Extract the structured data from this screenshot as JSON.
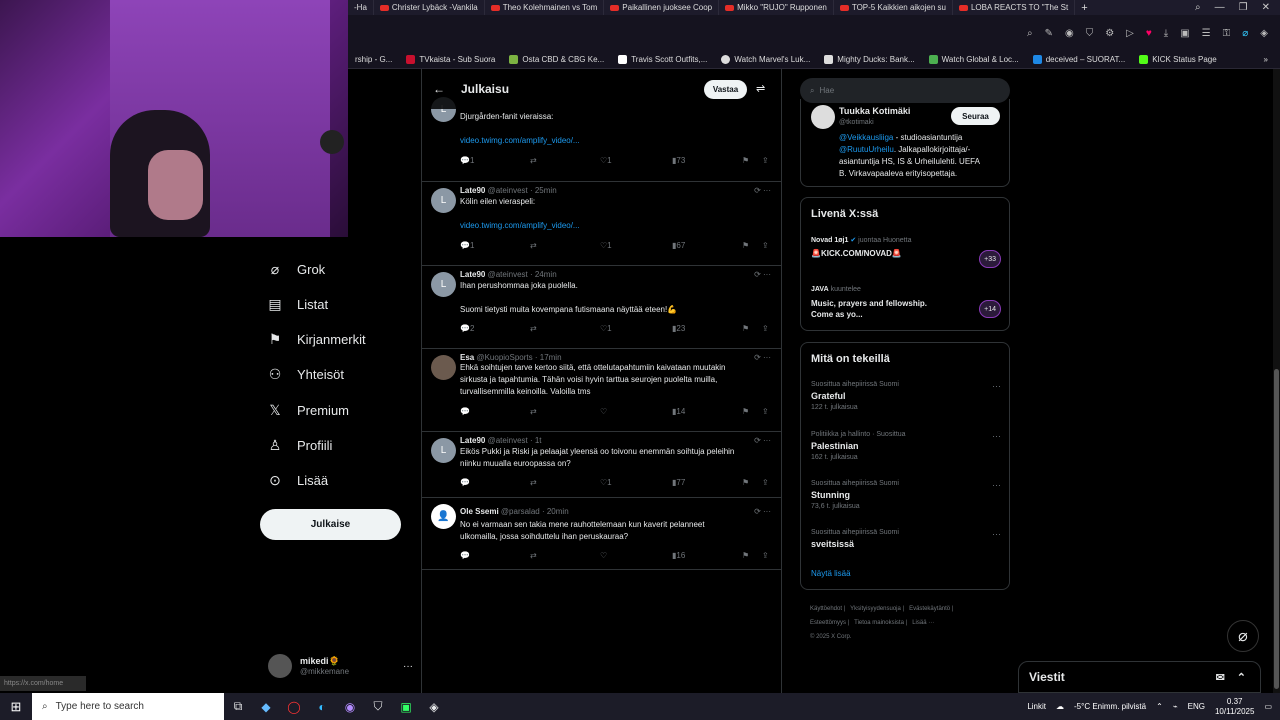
{
  "browser": {
    "tabs": [
      {
        "label": "-Ha"
      },
      {
        "label": "Christer Lybäck -Vankila"
      },
      {
        "label": "Theo Kolehmainen vs Tom"
      },
      {
        "label": "Paikallinen juoksee Coop"
      },
      {
        "label": "Mikko \"RUJO\" Rupponen"
      },
      {
        "label": "TOP-5 Kaikkien aikojen su"
      },
      {
        "label": "LOBA REACTS TO \"The St"
      }
    ],
    "bookmarks": [
      {
        "label": "rship - G...",
        "color": "#2d8cff"
      },
      {
        "label": "TVkaista - Sub Suora",
        "color": "#c8102e"
      },
      {
        "label": "Osta CBD & CBG Ke...",
        "color": "#7cb342"
      },
      {
        "label": "Travis Scott Outfits,...",
        "color": "#ffffff"
      },
      {
        "label": "Watch Marvel's Luk...",
        "color": "#dddddd"
      },
      {
        "label": "Mighty Ducks: Bank...",
        "color": "#dddddd"
      },
      {
        "label": "Watch Global & Loc...",
        "color": "#4caf50"
      },
      {
        "label": "deceived – SUORAT...",
        "color": "#1e88e5"
      },
      {
        "label": "KICK Status Page",
        "color": "#53fc18"
      }
    ],
    "status_url": "https://x.com/home"
  },
  "sidebar": {
    "items": [
      {
        "label": "Grok",
        "icon": "grok-icon"
      },
      {
        "label": "Listat",
        "icon": "list-icon"
      },
      {
        "label": "Kirjanmerkit",
        "icon": "bookmark-icon"
      },
      {
        "label": "Yhteisöt",
        "icon": "communities-icon"
      },
      {
        "label": "Premium",
        "icon": "x-icon"
      },
      {
        "label": "Profiili",
        "icon": "profile-icon"
      },
      {
        "label": "Lisää",
        "icon": "more-icon"
      }
    ],
    "post_label": "Julkaise",
    "account": {
      "name": "mikedi🌻",
      "handle": "@mikkemane"
    }
  },
  "post_column": {
    "title": "Julkaisu",
    "reply_label": "Vastaa",
    "tweets": [
      {
        "name": "Late90",
        "handle": "@ateinvest",
        "time": "24min",
        "avatar": "L",
        "avatar_color": "#8b98a5",
        "text": [
          "Djurgården-fanit vieraissa:"
        ],
        "link": "video.twimg.com/amplify_video/...",
        "replies": "1",
        "likes": "1",
        "views": "73"
      },
      {
        "name": "Late90",
        "handle": "@ateinvest",
        "time": "· 25min",
        "avatar": "L",
        "avatar_color": "#8b98a5",
        "text": [
          "Kölin eilen vieraspeli:"
        ],
        "link": "video.twimg.com/amplify_video/...",
        "replies": "1",
        "likes": "1",
        "views": "67"
      },
      {
        "name": "Late90",
        "handle": "@ateinvest",
        "time": "· 24min",
        "avatar": "L",
        "avatar_color": "#8b98a5",
        "text": [
          "Ihan perushommaa joka puolella.",
          "",
          "Suomi tietysti muita kovempana futismaana näyttää eteen!💪"
        ],
        "link": "",
        "replies": "2",
        "likes": "1",
        "views": "23"
      },
      {
        "name": "Esa",
        "handle": "@KuopioSports",
        "time": "· 17min",
        "avatar": "",
        "avatar_color": "#6b5a4e",
        "text": [
          "Ehkä soihtujen tarve kertoo siitä, että ottelutapahtumiin kaivataan muutakin",
          "sirkusta ja tapahtumia. Tähän voisi hyvin tarttua seurojen puolelta muilla,",
          "turvallisemmilla keinoilla. Valoilla tms"
        ],
        "link": "",
        "replies": "",
        "likes": "",
        "views": "14"
      },
      {
        "name": "Late90",
        "handle": "@ateinvest",
        "time": "· 1t",
        "avatar": "L",
        "avatar_color": "#8b98a5",
        "text": [
          "Eikös Pukki ja Riski ja pelaajat yleensä oo toivonu enemmän soihtuja peleihin",
          "niinku muualla euroopassa on?"
        ],
        "link": "",
        "replies": "",
        "likes": "1",
        "views": "77"
      },
      {
        "name": "Ole Ssemi",
        "handle": "@parsalad",
        "time": "· 20min",
        "avatar": "",
        "avatar_color": "#ffffff",
        "text": [
          "No ei varmaan sen takia mene rauhottelemaan kun kaverit pelanneet",
          "ulkomailla, jossa soihduttelu ihan peruskauraa?"
        ],
        "link": "",
        "replies": "",
        "likes": "",
        "views": "16"
      }
    ]
  },
  "right_rail": {
    "search_placeholder": "Hae",
    "profile": {
      "name": "Tuukka Kotimäki",
      "handle": "@tkotimaki",
      "follow": "Seuraa",
      "bio_link1": "@Veikkausliiga",
      "bio_text1": " - studioasiantuntija",
      "bio_link2": "@RuutuUrheilu",
      "bio_text2": ". Jalkapallokirjoittaja/-",
      "bio_line3": "asiantuntija HS, IS & Urheilulehti. UEFA",
      "bio_line4": "B. Virkavapaaleva erityisopettaja."
    },
    "live": {
      "title": "Livenä X:ssä",
      "items": [
        {
          "host": "Novad 1øj1",
          "status": "juontaa Huonetta",
          "title": "🚨KICK.COM/NOVAD🚨",
          "count": "+33"
        },
        {
          "host": "JAVA",
          "status": "kuuntelee",
          "title": "Music, prayers and fellowship. Come as yo...",
          "count": "+14"
        }
      ]
    },
    "trends": {
      "title": "Mitä on tekeillä",
      "items": [
        {
          "context": "Suosittua aihepiirissä Suomi",
          "name": "Grateful",
          "count": "122 t. julkaisua"
        },
        {
          "context": "Politiikka ja hallinto · Suosittua",
          "name": "Palestinian",
          "count": "162 t. julkaisua"
        },
        {
          "context": "Suosittua aihepiirissä Suomi",
          "name": "Stunning",
          "count": "73,6 t. julkaisua"
        },
        {
          "context": "Suosittua aihepiirissä Suomi",
          "name": "sveitsissä",
          "count": ""
        }
      ],
      "show_more": "Näytä lisää"
    },
    "footer": [
      "Käyttöehdot",
      "Yksityisyydensuoja",
      "Evästekäytäntö",
      "Esteettömyys",
      "Tietoa mainoksista",
      "Lisää ···",
      "© 2025 X Corp."
    ]
  },
  "messages_label": "Viestit",
  "taskbar": {
    "search_placeholder": "Type here to search",
    "links": "Linkit",
    "weather": "-5°C  Enimm. pilvistä",
    "lang": "ENG",
    "time": "0.37",
    "date": "10/11/2025"
  }
}
